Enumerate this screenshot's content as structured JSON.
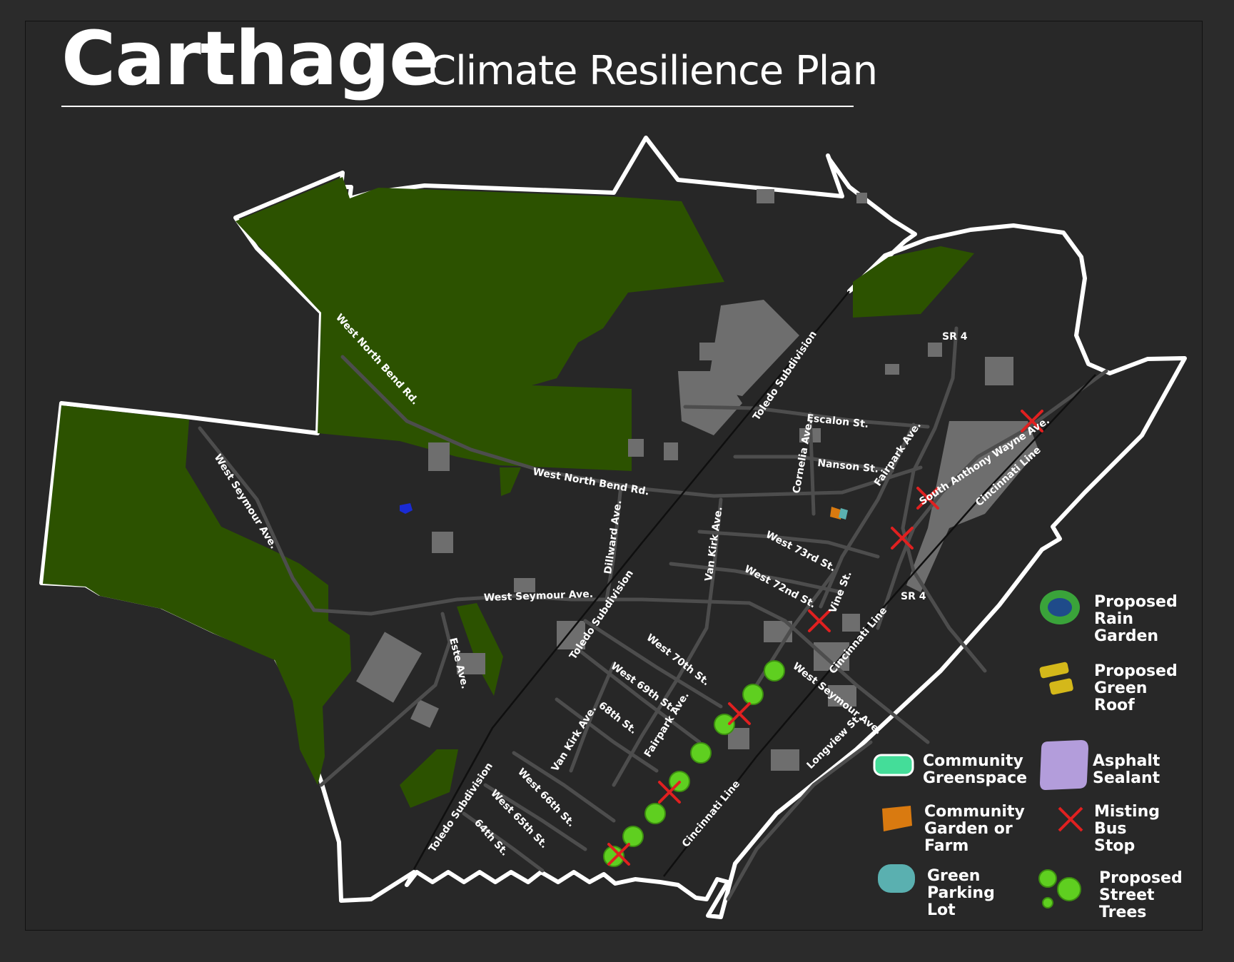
{
  "title": {
    "main": "Carthage",
    "sub": "Climate Resilience Plan"
  },
  "roads": {
    "west_north_bend_rd_1": "West North Bend Rd.",
    "west_north_bend_rd_2": "West North Bend Rd.",
    "west_seymour_ave_1": "West Seymour Ave.",
    "west_seymour_ave_2": "West Seymour Ave.",
    "west_seymour_ave_3": "West Seymour Ave.",
    "toledo_subdivision_1": "Toledo Subdivision",
    "toledo_subdivision_2": "Toledo Subdivision",
    "toledo_subdivision_3": "Toledo Subdivision",
    "sr4_1": "SR 4",
    "sr4_2": "SR 4",
    "escalon": "Escalon St.",
    "nanson": "Nanson St.",
    "cornelia": "Cornelia Ave.",
    "fairpark_1": "Fairpark Ave.",
    "fairpark_2": "Fairpark Ave.",
    "south_anthony_wayne": "South Anthony Wayne Ave.",
    "cincinnati_line_1": "Cincinnati Line",
    "cincinnati_line_2": "Cincinnati Line",
    "cincinnati_line_3": "Cincinnati Line",
    "dillward": "Dillward Ave.",
    "van_kirk_1": "Van Kirk Ave.",
    "van_kirk_2": "Van Kirk Ave.",
    "west_73rd": "West 73rd St.",
    "west_72nd": "West 72nd St.",
    "vine": "Vine St.",
    "este": "Este Ave.",
    "west_70th": "West 70th St.",
    "west_69th": "West 69th St.",
    "st_68th": "68th St.",
    "west_66th": "West 66th St.",
    "west_65th": "West 65th St.",
    "st_64th": "64th St.",
    "longview": "Longview St."
  },
  "legend": {
    "rain_garden": "Proposed\nRain\nGarden",
    "green_roof": "Proposed\nGreen\nRoof",
    "community_greenspace": "Community\nGreenspace",
    "asphalt_sealant": "Asphalt\nSealant",
    "community_garden": "Community\nGarden or\nFarm",
    "misting_bus_stop": "Misting\nBus\nStop",
    "green_parking_lot": "Green\nParking\nLot",
    "street_trees": "Proposed\nStreet\nTrees"
  },
  "colors": {
    "background": "#2b2b2b",
    "greenspace_forest": "#2c5200",
    "boundary": "#ffffff",
    "buildings": "#6e6e6e",
    "roads": "#4a4a4a",
    "rain_garden_outer": "#3aa33a",
    "rain_garden_inner": "#1f4b8a",
    "green_roof": "#d4b81a",
    "community_greenspace": "#44dd99",
    "asphalt_sealant": "#b39ddb",
    "community_garden": "#d97a10",
    "green_parking_lot": "#5ab0b0",
    "misting_bus_stop": "#e02020",
    "street_trees": "#5fcf20"
  }
}
